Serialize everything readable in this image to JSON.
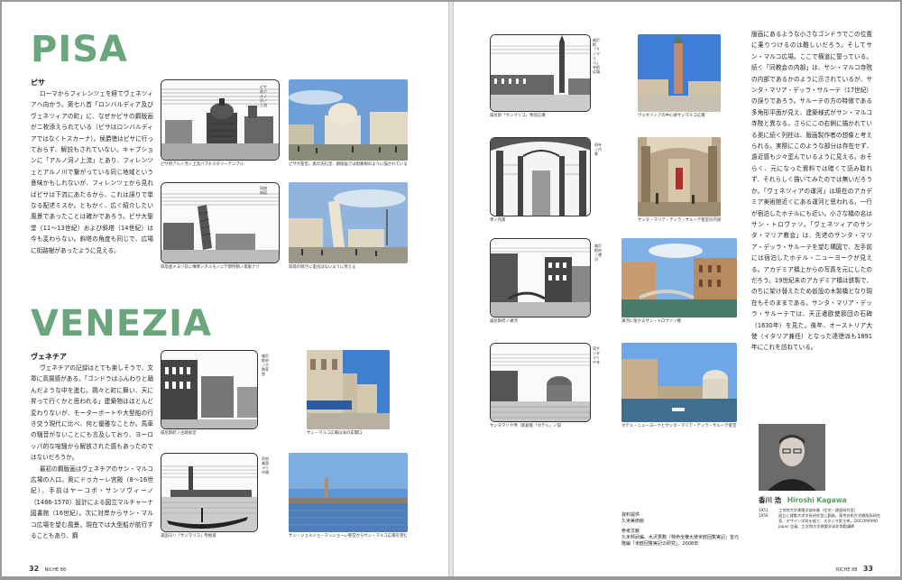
{
  "pisa": {
    "title": "PISA",
    "subtitle": "ピサ",
    "text": "ローマからフィレンツェを経てヴェネツィアへ向かう。第七八首「ロンバルディア及びヴェネツィアの町」に、なぜかピサの鋼版画が二枚添えられている（ピサはロンバルディアではなくトスカーナ）。侯爵徳はピサに行っておらず、解説もされていない。キャプションに「アルノ河ノ上流」とあり、フィレンツェとアルノ川で繋がっている同じ地域という意味かもしれないが、フィレンツェから見ればピサは下流にあたるから、これは誤りで単なる配述ミスか。ともかく、広く紹介したい風景であったことは確かであろう。ピサ大聖堂（11〜13世紀）および斜塔（14世紀）は今も変わらない。斜塔の角度も同じで、広場に街路樹があったように見える。",
    "figures": [
      {
        "caption": "ピサ府アルノ河ノ上流バプチスタリーテンプル"
      },
      {
        "caption": "ピサ大聖堂。奥の洗礼堂、鋼版画では街路樹のように描かれている"
      },
      {
        "caption": "斜塔並メヨリ前ニ傳寒シタルモノニテ現時傾ノ塔家ナリ"
      },
      {
        "caption": "斜塔の傾きに変化はないように見える"
      }
    ],
    "engraving_labels": [
      "ピサ府アルノ河ノ上流",
      "同府斜塔"
    ]
  },
  "venezia": {
    "title": "VENEZIA",
    "subtitle": "ヴェネチア",
    "text1": "ヴェネチアの記録はとても楽しそうで、文章に高揚感がある。「ゴンドラはふんわりと踊んだような中を進む。鶏々と町に舞い、天に昇って行くかと思われる」建築物はほとんど変わりないが、モーターボートや大型船の行き交う現代に比べ、何と優雅なことか。馬車の騒音がないことにも言及しており、ヨーロッパ的な喧騒から解放された感もあったのではないだろうか。",
    "text2": "最初の鋼版画はヴェネチアのサン・マルコ広場の入口。奥にドゥカーレ宮殿（8〜16世紀）、手前はヤーコポ・サンソヴィーノ（1486-1570）設計による図立マルチャーナ図書館（16世紀）。次に対岸からサン・マルコ広場を望む風景。現在では大型船が航行することもあり、鋼",
    "figures": [
      {
        "caption": "威尼斯府ノ古跡家堂"
      },
      {
        "caption": "サン・マルコ広場は海の玄関口"
      },
      {
        "caption": "美国ヨリ「サンマリコ」寺極道"
      },
      {
        "caption": "サン・ジョルジョ・マッジョーレ聖堂からサン・マルコ広場を望む"
      }
    ],
    "engraving_labels": [
      "威尼斯府ノ古跡家堂",
      "同府美国ヨリ市場"
    ]
  },
  "right": {
    "figures": [
      {
        "caption": "威尼斯「サンマリコ」寺前広場"
      },
      {
        "caption": "ヴェネツィアの中心地サンマルコ広場"
      },
      {
        "caption": "寺ノ内景"
      },
      {
        "caption": "サンタ・マリア・デッラ・サルーテ聖堂の内部"
      },
      {
        "caption": "威尼斯府ノ運河"
      },
      {
        "caption": "運河に架かるサン・トロヴァソ橋"
      },
      {
        "caption": "サンタマリヤ寺（新創客「ホテル」ノ前"
      },
      {
        "caption": "ホテル・ニューヨークとサンタ・マリア・デッラ・サルーテ聖堂"
      }
    ],
    "engraving_labels": [
      "威尼斯「サンマリコ」寺前広場",
      "同寺ノ内景",
      "威尼斯府ノ運河",
      "同サンタマリヤ寺"
    ],
    "text": "版画にあるような小さなゴンドラでこの位置に乗りつけるのは難しいだろう。そしてサン・マルコ広場。ここで横道に誓っている。続く「同教会の内部」は、サン・マルコ寺院の内部であるかのように示されているが、サンタ・マリア・デッラ・サルーテ（17世紀）の誤りであろう。サルーテの方の特徴である多角形平面が見え、建築様式がサン・マルコ寺院と異なる。さらにこの右側に描かれている奥に続く列柱は、版画製作者の想像と考えられる。実際にこのような部分は存在せず、遠近感も少々歪んでいるように見える。おそらく、元になった資料では暗くて読み取れず、それらしく描いてみたのでは無いだろうか。「ヴェネツィアの運河」は現在のアカデミア美術館近くにある運河と思われる。一行が宿泊したホテルにも近い。小さな橋の名はサン・トロヴァソ。「ヴェネツィアのサンタ・マリア教会」は、先述のサンタ・マリア・デッラ・サルーテを望む構図で、左手前には宿泊したホテル・ニューヨークが見える。アカデミア橋上からの写真を元にしたのだろう。19世紀末のアカデミア橋は鉄製で、のちに架け替えたため仮設の木製橋となり現在もそのままである。サンタ・マリア・デッラ・サルーテでは、天正遣欧使節団の石碑（1630年）を見た。後年、オーストリア大使（イタリア兼任）となった達徳派も1891年にこれを訪ねている。"
  },
  "credits": {
    "lines": [
      "資料提供",
      "久米美術館",
      "",
      "参考文献",
      "久米邦武編、水沢貫勲『特命全権大使米欧回覧実記』皆元隆編「米欧回覧実記の研究」、2008年"
    ]
  },
  "author": {
    "name_ja": "香川 浩",
    "name_en": "Hiroshi Kagawa",
    "bio": [
      {
        "year": "1951",
        "text": "工学院大学建築学部卒業（住宅・建設研究室）"
      },
      {
        "year": "1956",
        "text": "設立に建築大学学長研究室に勤務。東京芸術大学鋼版画研究室、デザイン学科を経て、スタジオ室主宰。DOCOMOMO Japan 会員、工学院大学建築学部非常勤講師"
      }
    ]
  },
  "folio": {
    "left_num": "32",
    "left_label": "NICHE 88",
    "right_num": "33",
    "right_label": "NICHE 88"
  },
  "colors": {
    "accent": "#6aa57c"
  }
}
